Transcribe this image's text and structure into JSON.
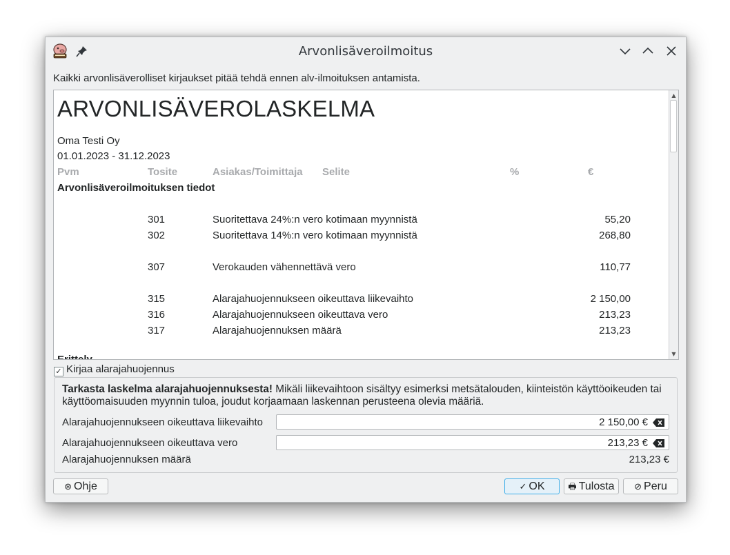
{
  "window": {
    "title": "Arvonlisäveroilmoitus",
    "info_text": "Kaikki arvonlisäverolliset kirjaukset pitää tehdä ennen alv-ilmoituksen antamista."
  },
  "report": {
    "title": "ARVONLISÄVEROLASKELMA",
    "company": "Oma Testi Oy",
    "period": "01.01.2023 - 31.12.2023",
    "columns": [
      "Pvm",
      "Tosite",
      "Asiakas/Toimittaja",
      "Selite",
      "%",
      "€"
    ],
    "section_title": "Arvonlisäveroilmoituksen tiedot",
    "rows": [
      {
        "code": "301",
        "description": "Suoritettava 24%:n vero kotimaan myynnistä",
        "amount": "55,20"
      },
      {
        "code": "302",
        "description": "Suoritettava 14%:n vero kotimaan myynnistä",
        "amount": "268,80"
      },
      {
        "code": "307",
        "description": "Verokauden vähennettävä vero",
        "amount": "110,77"
      },
      {
        "code": "315",
        "description": "Alarajahuojennukseen oikeuttava liikevaihto",
        "amount": "2 150,00"
      },
      {
        "code": "316",
        "description": "Alarajahuojennukseen oikeuttava vero",
        "amount": "213,23"
      },
      {
        "code": "317",
        "description": "Alarajahuojennuksen määrä",
        "amount": "213,23"
      }
    ],
    "cut_off_text": "Erittely"
  },
  "checkbox": {
    "label": "Kirjaa alarajahuojennus",
    "checked": true
  },
  "relief": {
    "warning_bold": "Tarkasta laskelma alarajahuojennuksesta!",
    "warning_text": " Mikäli liikevaihtoon sisältyy esimerksi metsätalouden, kiinteistön käyttöoikeuden tai käyttöomaisuuden myynnin tuloa, joudut korjaamaan laskennan perusteena olevia määriä.",
    "turnover_label": "Alarajahuojennukseen oikeuttava liikevaihto",
    "turnover_value": "2 150,00 €",
    "tax_label": "Alarajahuojennukseen oikeuttava vero",
    "tax_value": "213,23 €",
    "amount_label": "Alarajahuojennuksen määrä",
    "amount_value": "213,23 €"
  },
  "buttons": {
    "help": "Ohje",
    "ok": "OK",
    "print": "Tulosta",
    "cancel": "Peru"
  },
  "colors": {
    "accent": "#3daee9",
    "window_bg": "#eff0f1",
    "header_gray": "#a8aaad"
  }
}
